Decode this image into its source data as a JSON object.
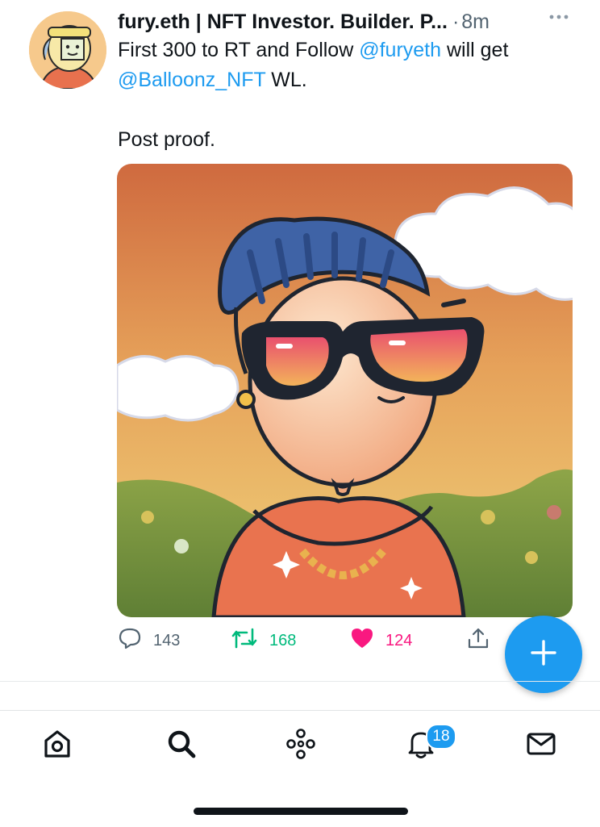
{
  "tweet": {
    "author_name": "fury.eth | NFT Investor. Builder. P...",
    "separator": "·",
    "timestamp": "8m",
    "text": {
      "line1_pre": "First 300 to RT and Follow ",
      "mention1": "@furyeth",
      "line1_post": " will get",
      "mention2": "@Balloonz_NFT",
      "line2_post": " WL.",
      "line3": "Post proof."
    },
    "stats": {
      "replies": "143",
      "retweets": "168",
      "likes": "124"
    }
  },
  "notifications": {
    "badge": "18"
  },
  "colors": {
    "accent": "#1d9bf0",
    "retweet": "#00ba7c",
    "like": "#f91880",
    "muted": "#536471"
  },
  "icons": [
    "more-icon",
    "reply-icon",
    "retweet-icon",
    "heart-icon",
    "share-icon",
    "compose-plus-icon",
    "home-icon",
    "search-icon",
    "spaces-icon",
    "bell-icon",
    "mail-icon"
  ]
}
